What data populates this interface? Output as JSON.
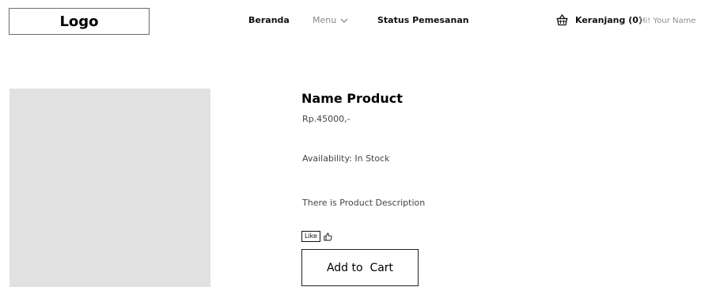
{
  "header": {
    "logo": "Logo",
    "nav": {
      "beranda": "Beranda",
      "menu": "Menu",
      "status": "Status Pemesanan"
    },
    "cart_label": "Keranjang (0)",
    "greeting": "Hi! Your Name"
  },
  "product": {
    "name": "Name Product",
    "price": "Rp.45000,-",
    "availability": "Availability: In Stock",
    "description": "There is Product Description",
    "like_label": "Like",
    "add_to_cart_label": "Add to  Cart"
  },
  "icons": {
    "cart": "shopping-basket-icon",
    "menu_chevron": "chevron-down-icon",
    "like": "thumbs-up-icon"
  },
  "colors": {
    "image_placeholder": "#e1e1e1",
    "muted_text": "#8a8a8a"
  }
}
